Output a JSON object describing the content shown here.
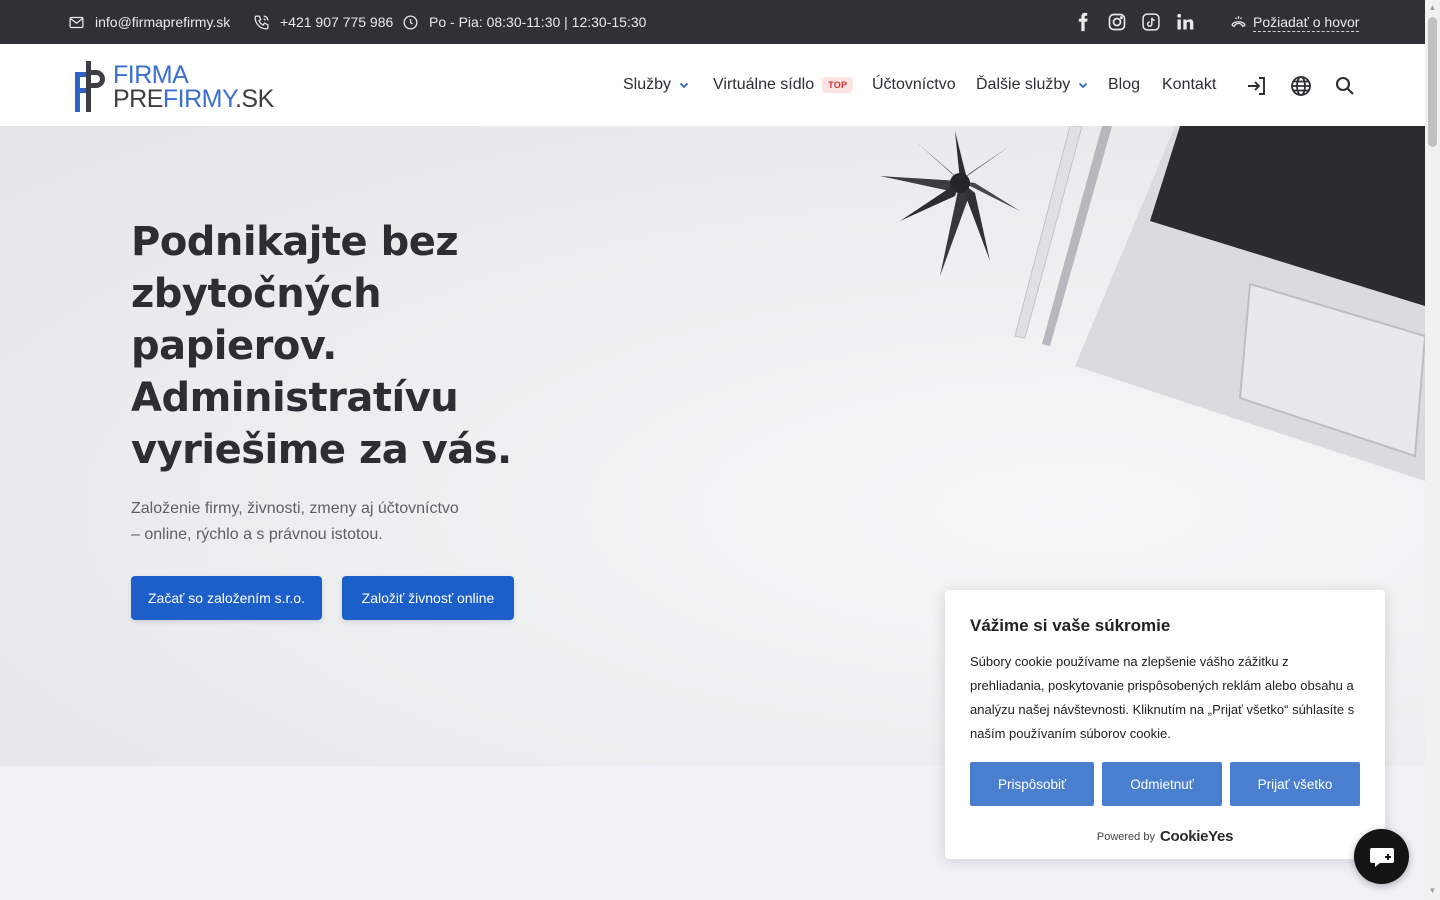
{
  "topbar": {
    "email": "info@firmaprefirmy.sk",
    "phone": "+421 907 775 986",
    "hours": "Po - Pia: 08:30-11:30 | 12:30-15:30",
    "social": [
      "facebook-icon",
      "instagram-icon",
      "tiktok-icon",
      "linkedin-icon"
    ],
    "callback_label": "Požiadať o hovor"
  },
  "logo": {
    "line1": "FIRMA",
    "line2_a": "PRE",
    "line2_b": "FIRMY",
    "line2_c": ".SK"
  },
  "nav": {
    "items": [
      {
        "label": "Služby",
        "has_dropdown": true
      },
      {
        "label": "Virtuálne sídlo",
        "badge": "TOP"
      },
      {
        "label": "Účtovníctvo"
      },
      {
        "label": "Ďalšie služby",
        "has_dropdown": true
      },
      {
        "label": "Blog"
      },
      {
        "label": "Kontakt"
      }
    ],
    "icons": [
      "login-icon",
      "globe-icon",
      "search-icon"
    ]
  },
  "hero": {
    "title": "Podnikajte bez zbytočných papierov. Administratívu vyriešime za vás.",
    "subtitle": "Založenie firmy, živnosti, zmeny aj účtovníctvo – online, rýchlo a s právnou istotou.",
    "btn_primary": "Začať so založením s.r.o.",
    "btn_secondary": "Založiť živnosť online"
  },
  "cookie": {
    "title": "Vážime si vaše súkromie",
    "text": "Súbory cookie používame na zlepšenie vášho zážitku z prehliadania, poskytovanie prispôsobených reklám alebo obsahu a analýzu našej návštevnosti. Kliknutím na „Prijať všetko“ súhlasíte s naším používaním súborov cookie.",
    "btn_customize": "Prispôsobiť",
    "btn_reject": "Odmietnuť",
    "btn_accept": "Prijať všetko",
    "powered_by": "Powered by",
    "brand": "CookieYes"
  },
  "colors": {
    "topbar_bg": "#2f3136",
    "primary": "#1d5fc9",
    "cookie_btn": "#4a7fd0",
    "badge_text": "#d6312a"
  }
}
